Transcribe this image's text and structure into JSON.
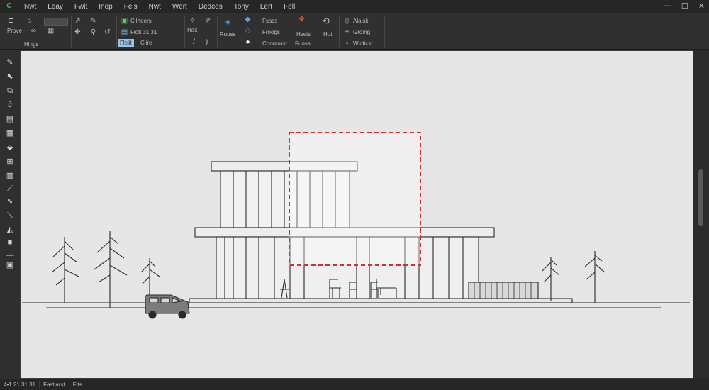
{
  "menu": {
    "items": [
      "Nwt",
      "Leay",
      "Fwit",
      "Inop",
      "Fels",
      "Nwt",
      "Wert",
      "Dedces",
      "Tony",
      "Lert",
      "Fell"
    ]
  },
  "ribbon": {
    "prove_label": "Prove",
    "hings_label": "Hings",
    "cilrteers_label": "Cilrteers",
    "fioti_label": "Fioti 31 31",
    "fleiit_label": "Fleiit",
    "ciirie_label": "Ciire",
    "hait_label": "Hait",
    "ruoss_label": "Ruoss",
    "fsass_label": "Fsass",
    "froogs_label": "Froogs",
    "coontrust_label": "Coontrust",
    "hseis_label": "Hseis",
    "fuoss_label": "Fuoss",
    "hut_label": "Hut",
    "alaisk_label": "Alaisk",
    "groing_label": "Groing",
    "wicticst_label": "Wicticst"
  },
  "status": {
    "coords": "4•1 21 31 31",
    "mode": "Fastlarst",
    "zoom": "Fits"
  },
  "colors": {
    "selection": "#d03030",
    "canvas": "#e6e6e6",
    "line": "#2a2a2a",
    "accent": "#33c24a"
  },
  "icons": {
    "app": "app-logo-icon",
    "toolbox": [
      "pencil-icon",
      "select-icon",
      "layers-icon",
      "curve-icon",
      "stack-icon",
      "grid-icon",
      "fill-icon",
      "table-icon",
      "brush-icon",
      "hand-icon",
      "line-tool-icon",
      "eraser-icon",
      "shape-icon",
      "layout-icon"
    ]
  }
}
